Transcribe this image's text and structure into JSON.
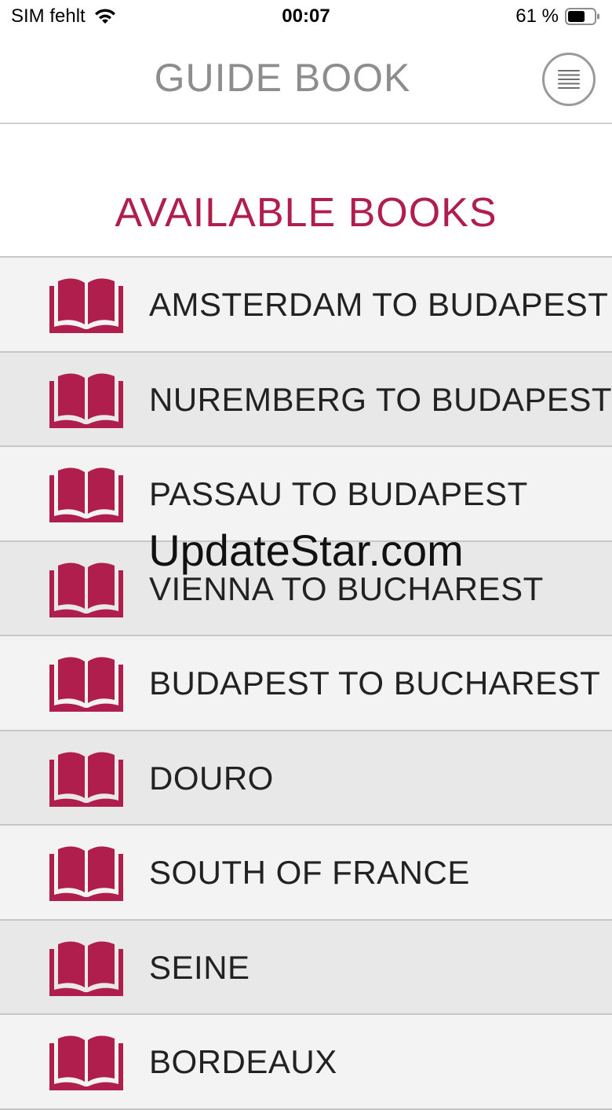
{
  "status_bar": {
    "carrier": "SIM fehlt",
    "time": "00:07",
    "battery": "61 %"
  },
  "header": {
    "title": "GUIDE BOOK",
    "menu_icon": "menu-lines-icon"
  },
  "section_title": "AVAILABLE BOOKS",
  "books": [
    {
      "label": "AMSTERDAM TO BUDAPEST"
    },
    {
      "label": "NUREMBERG TO BUDAPEST"
    },
    {
      "label": "PASSAU TO BUDAPEST"
    },
    {
      "label": "VIENNA TO BUCHAREST"
    },
    {
      "label": "BUDAPEST TO BUCHAREST"
    },
    {
      "label": "DOURO"
    },
    {
      "label": "SOUTH OF FRANCE"
    },
    {
      "label": "SEINE"
    },
    {
      "label": "BORDEAUX"
    }
  ],
  "watermark": "UpdateStar.com",
  "colors": {
    "accent": "#b01e4e",
    "header_text": "#8d8d8d",
    "row_light": "#f3f3f3",
    "row_dark": "#e8e8e8"
  }
}
